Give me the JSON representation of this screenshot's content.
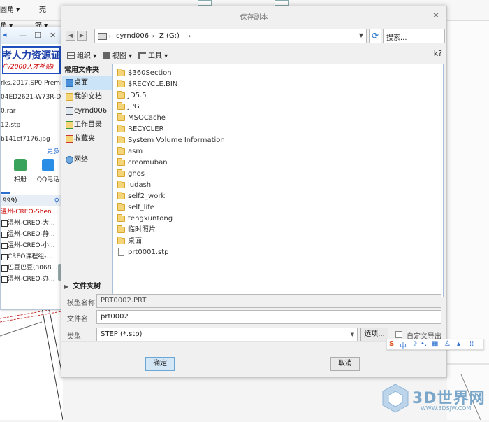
{
  "background_app": {
    "menu1": "圆角 ▾",
    "menu2": "壳",
    "menu3": "角 ▾",
    "menu4": "筋 ▾"
  },
  "chat_panel": {
    "banner_title": "考人力资源证",
    "banner_subtitle": "户/2000人才补贴)",
    "files": [
      "rks.2017.SP0.Premi...",
      "04ED2621-W73R-D...",
      "0.rar",
      "12.stp",
      "b141cf7176.jpg"
    ],
    "more": "更多",
    "apps": [
      {
        "label": "相册",
        "icon": "photo-icon",
        "color": "#3aa35b"
      },
      {
        "label": "QQ电话",
        "icon": "phone-icon",
        "color": "#2b8ee6"
      }
    ],
    "search_text": ".999)",
    "contacts": [
      {
        "name": "温州-CREO-Shen...",
        "red": true
      },
      {
        "name": "温州-CREO-大...",
        "red": false
      },
      {
        "name": "温州-CREO-静...",
        "red": false
      },
      {
        "name": "温州-CREO-小...",
        "red": false
      },
      {
        "name": "CREO课程组-...",
        "red": false
      },
      {
        "name": "巴豆巴豆(3068...",
        "red": false
      },
      {
        "name": "温州-CREO-办...",
        "red": false
      }
    ]
  },
  "dialog": {
    "title": "保存副本",
    "address": {
      "seg1": "cyrnd006",
      "seg2": "Z (G:)"
    },
    "search_placeholder": "搜索...",
    "toolbar": {
      "organize": "组织",
      "view": "视图",
      "tools": "工具"
    },
    "left_pane": {
      "header": "常用文件夹",
      "items": [
        {
          "label": "桌面",
          "icon": "desktop-icon",
          "selected": true
        },
        {
          "label": "我的文档",
          "icon": "documents-icon",
          "selected": false
        },
        {
          "label": "cyrnd006",
          "icon": "computer-icon",
          "selected": false
        },
        {
          "label": "工作目录",
          "icon": "working-dir-icon",
          "selected": false
        },
        {
          "label": "收藏夹",
          "icon": "favorites-icon",
          "selected": false
        },
        {
          "label": "网络",
          "icon": "network-icon",
          "selected": false
        }
      ]
    },
    "files": [
      {
        "name": "$360Section",
        "type": "folder"
      },
      {
        "name": "$RECYCLE.BIN",
        "type": "folder"
      },
      {
        "name": "JD5.5",
        "type": "folder"
      },
      {
        "name": "JPG",
        "type": "folder"
      },
      {
        "name": "MSOCache",
        "type": "folder"
      },
      {
        "name": "RECYCLER",
        "type": "folder"
      },
      {
        "name": "System Volume Information",
        "type": "folder"
      },
      {
        "name": "asm",
        "type": "folder"
      },
      {
        "name": "creomuban",
        "type": "folder"
      },
      {
        "name": "ghos",
        "type": "folder"
      },
      {
        "name": "ludashi",
        "type": "folder"
      },
      {
        "name": "self2_work",
        "type": "folder"
      },
      {
        "name": "self_life",
        "type": "folder"
      },
      {
        "name": "tengxuntong",
        "type": "folder"
      },
      {
        "name": "临时照片",
        "type": "folder"
      },
      {
        "name": "桌面",
        "type": "folder"
      },
      {
        "name": "prt0001.stp",
        "type": "file"
      }
    ],
    "folder_tree_label": "文件夹树",
    "model_name_label": "模型名称",
    "model_name_value": "PRT0002.PRT",
    "file_name_label": "文件名",
    "file_name_value": "prt0002",
    "type_label": "类型",
    "type_value": "STEP (*.stp)",
    "options_button": "选项...",
    "custom_export_label": "自定义导出",
    "ok_button": "确定",
    "cancel_button": "取消"
  },
  "ime": {
    "lang": "中"
  },
  "watermark": {
    "text": "3D世界网",
    "url": "WWW.3DSJW.COM"
  }
}
